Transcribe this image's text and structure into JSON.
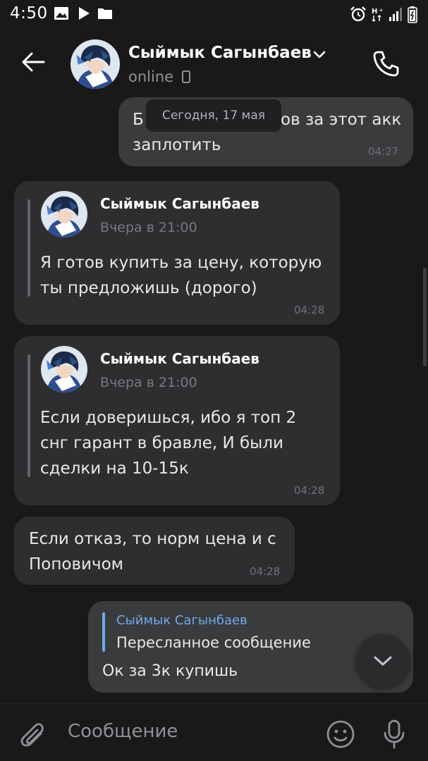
{
  "status_bar": {
    "time": "4:50"
  },
  "header": {
    "contact_name": "Сыймык Сагынбаев",
    "status": "online"
  },
  "date_chip": "Сегодня, 17 мая",
  "messages": [
    {
      "direction": "out",
      "lines": [
        "Б",
        "ов за этот акк",
        "заплотить"
      ],
      "time": "04:27"
    },
    {
      "direction": "in",
      "forwarded": {
        "name": "Сыймык Сагынбаев",
        "date": "Вчера в 21:00"
      },
      "lines": [
        "Я готов купить за цену, которую",
        "ты предложишь (дорого)"
      ],
      "time": "04:28"
    },
    {
      "direction": "in",
      "forwarded": {
        "name": "Сыймык Сагынбаев",
        "date": "Вчера в 21:00"
      },
      "lines": [
        "Если доверишься, ибо я топ 2",
        "снг гарант в бравле, И были",
        "сделки на 10-15к"
      ],
      "time": "04:28"
    },
    {
      "direction": "in",
      "lines": [
        "Если отказ, то норм цена и с",
        "Поповичом"
      ],
      "time": "04:28"
    },
    {
      "direction": "out",
      "reply": {
        "name": "Сыймык Сагынбаев",
        "text": "Пересланное сообщение"
      },
      "lines": [
        "Ок за 3к купишь"
      ]
    }
  ],
  "composer": {
    "placeholder": "Сообщение"
  },
  "colors": {
    "background": "#19191a",
    "bubble_in": "#2e2e30",
    "bubble_out": "#3a3b3d",
    "reply_accent": "#71aaeb",
    "muted_text": "#8d9196"
  }
}
